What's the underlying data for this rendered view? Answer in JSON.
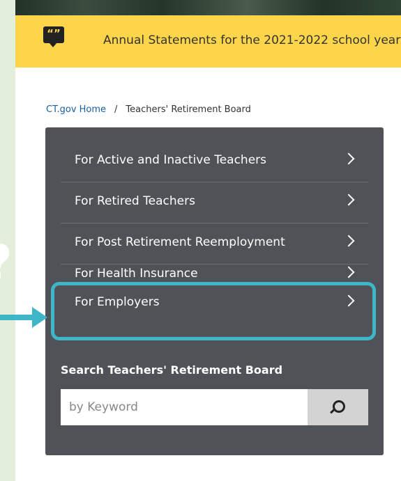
{
  "banner": {
    "icon": "quote-icon",
    "text": "Annual Statements for the 2021-2022 school year"
  },
  "breadcrumb": {
    "home": "CT.gov Home",
    "separator": "/",
    "current": "Teachers' Retirement Board"
  },
  "nav": {
    "items": [
      {
        "label": "For Active and Inactive Teachers"
      },
      {
        "label": "For Retired Teachers"
      },
      {
        "label": "For Post Retirement Reemployment"
      },
      {
        "label": "For Health Insurance"
      },
      {
        "label": "For Employers"
      }
    ],
    "chevron_icon": "chevron-right-icon"
  },
  "search": {
    "title": "Search Teachers' Retirement Board",
    "placeholder": "by Keyword",
    "button_icon": "search-icon"
  },
  "colors": {
    "banner": "#fcd54a",
    "panel": "#4f5256",
    "highlight": "#3eb6c7",
    "link": "#1a5fa3",
    "left_strip": "#e3eedb"
  }
}
